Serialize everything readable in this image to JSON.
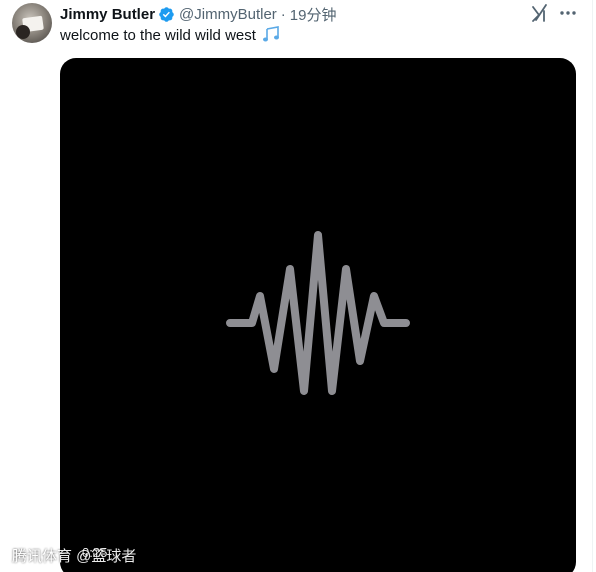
{
  "tweet": {
    "display_name": "Jimmy Butler",
    "handle": "@JimmyButler",
    "separator": "·",
    "time": "19分钟",
    "text": "welcome to the wild wild west",
    "text_icon": "musical-notes-icon"
  },
  "media": {
    "type": "audio-waveform",
    "duration": "0:25"
  },
  "watermark": {
    "text": "腾讯体育 @篮球者"
  },
  "colors": {
    "verified_blue": "#1d9bf0",
    "text_primary": "#0f1419",
    "text_secondary": "#536471",
    "waveform": "#8e8e93",
    "media_bg": "#000000"
  },
  "icons": {
    "verified": "verified-badge-icon",
    "grok": "grok-icon",
    "more": "more-options-icon"
  }
}
